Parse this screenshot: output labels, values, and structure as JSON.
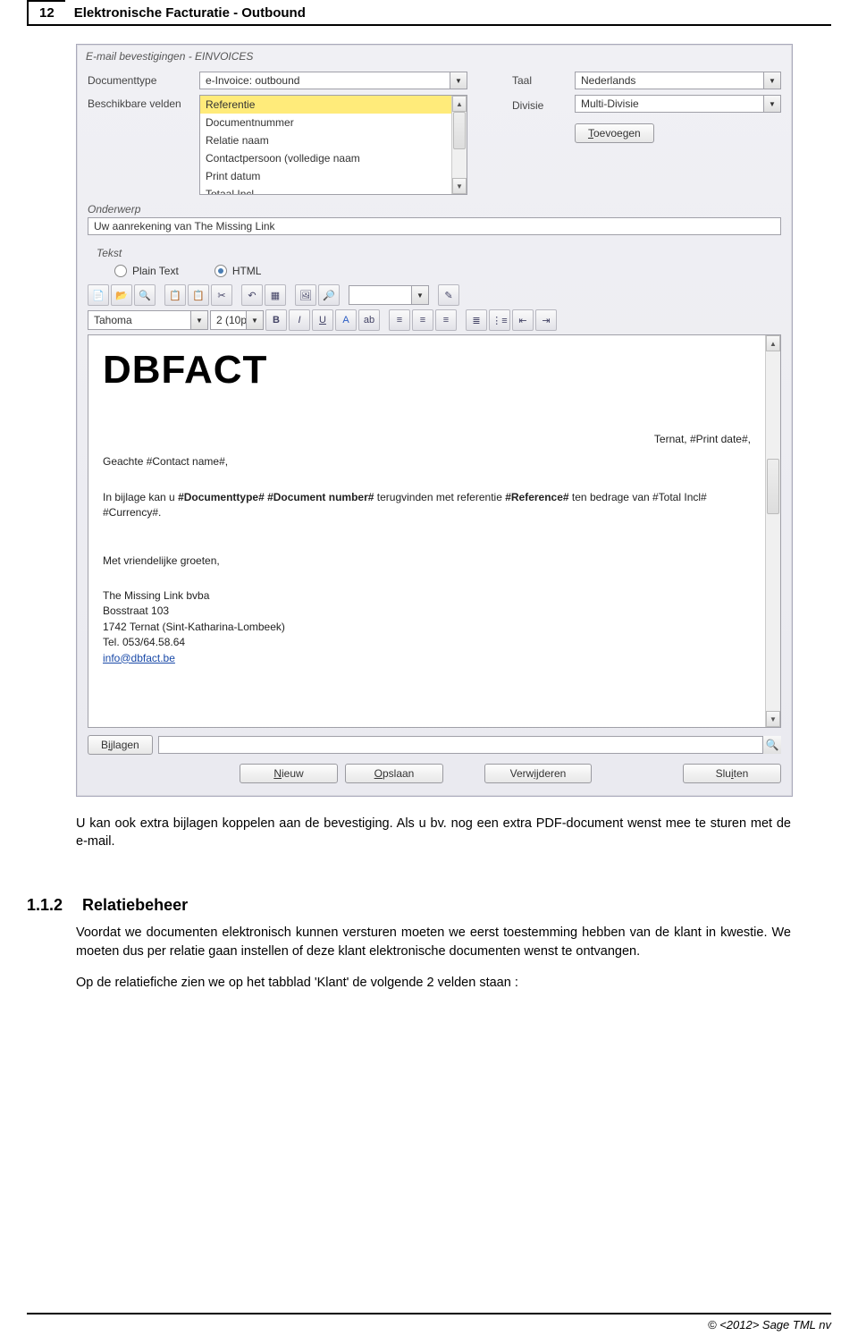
{
  "header": {
    "page_number": "12",
    "title": "Elektronische Facturatie - Outbound"
  },
  "app": {
    "titlebar": "E-mail bevestigingen   -   EINVOICES",
    "labels": {
      "documenttype": "Documenttype",
      "beschikbare_velden": "Beschikbare velden",
      "taal": "Taal",
      "divisie": "Divisie",
      "onderwerp": "Onderwerp",
      "tekst": "Tekst"
    },
    "documenttype_value": "e-Invoice: outbound",
    "taal_value": "Nederlands",
    "divisie_value": "Multi-Divisie",
    "fields_list": [
      "Referentie",
      "Documentnummer",
      "Relatie naam",
      "Contactpersoon (volledige naam",
      "Print datum",
      "Totaal Incl."
    ],
    "add_button": "Toevoegen",
    "onderwerp_value": "Uw aanrekening van The Missing Link",
    "radio": {
      "plain": "Plain Text",
      "html": "HTML"
    },
    "font_name": "Tahoma",
    "font_size": "2 (10p",
    "editor": {
      "logo": "DBFACT",
      "date_line": "Ternat, #Print date#,",
      "greeting": "Geachte #Contact name#,",
      "body": "In bijlage kan u #Documenttype# #Document number# terugvinden met referentie #Reference# ten bedrage van #Total Incl# #Currency#.",
      "body_bold": {
        "a": "#Documenttype# #Document number#",
        "b": "#Reference#"
      },
      "closing": "Met vriendelijke groeten,",
      "sig1": "The Missing Link bvba",
      "sig2": "Bosstraat 103",
      "sig3": "1742 Ternat (Sint-Katharina-Lombeek)",
      "sig4": "Tel. 053/64.58.64",
      "email": "info@dbfact.be"
    },
    "bijlagen_btn": "Bijlagen",
    "buttons": {
      "nieuw": "Nieuw",
      "opslaan": "Opslaan",
      "verwijderen": "Verwijderen",
      "sluiten": "Sluiten"
    }
  },
  "doc": {
    "para_after_img": "U kan ook extra bijlagen koppelen aan de bevestiging. Als u bv. nog een extra PDF-document wenst mee te sturen met de e-mail.",
    "section_num": "1.1.2",
    "section_title": "Relatiebeheer",
    "para1": "Voordat we documenten elektronisch kunnen versturen moeten we eerst toestemming hebben van de klant in kwestie. We moeten dus per relatie gaan instellen of deze klant elektronische documenten wenst te ontvangen.",
    "para2": "Op de relatiefiche zien we op het tabblad 'Klant' de volgende 2 velden staan :"
  },
  "footer": "© <2012> Sage TML nv"
}
